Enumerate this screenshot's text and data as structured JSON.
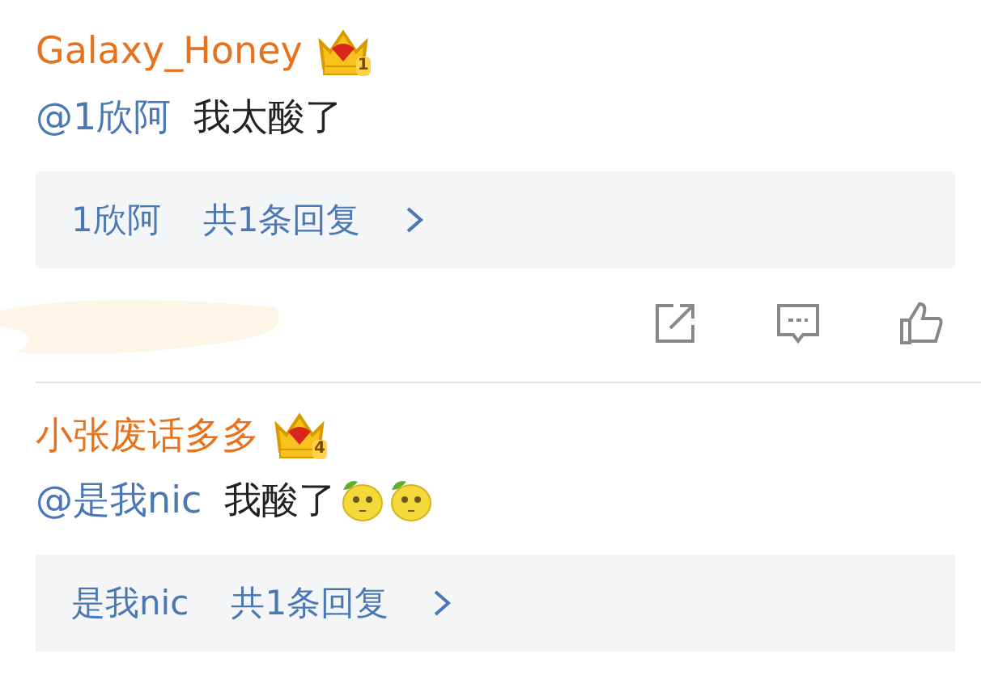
{
  "comments": [
    {
      "user": "Galaxy_Honey",
      "crown_badge": "1",
      "mention": "@1欣阿",
      "text": "我太酸了",
      "replies": {
        "user": "1欣阿",
        "count": "共1条回复"
      },
      "actions": [
        {
          "kind": "share"
        },
        {
          "kind": "comment"
        },
        {
          "kind": "like"
        }
      ]
    },
    {
      "user": "小张废话多多",
      "crown_badge": "4",
      "mention": "@是我nic",
      "text": "我酸了",
      "emojis": [
        {
          "kind": "lemon"
        },
        {
          "kind": "lemon"
        }
      ],
      "replies": {
        "user": "是我nic",
        "count": "共1条回复"
      }
    }
  ]
}
